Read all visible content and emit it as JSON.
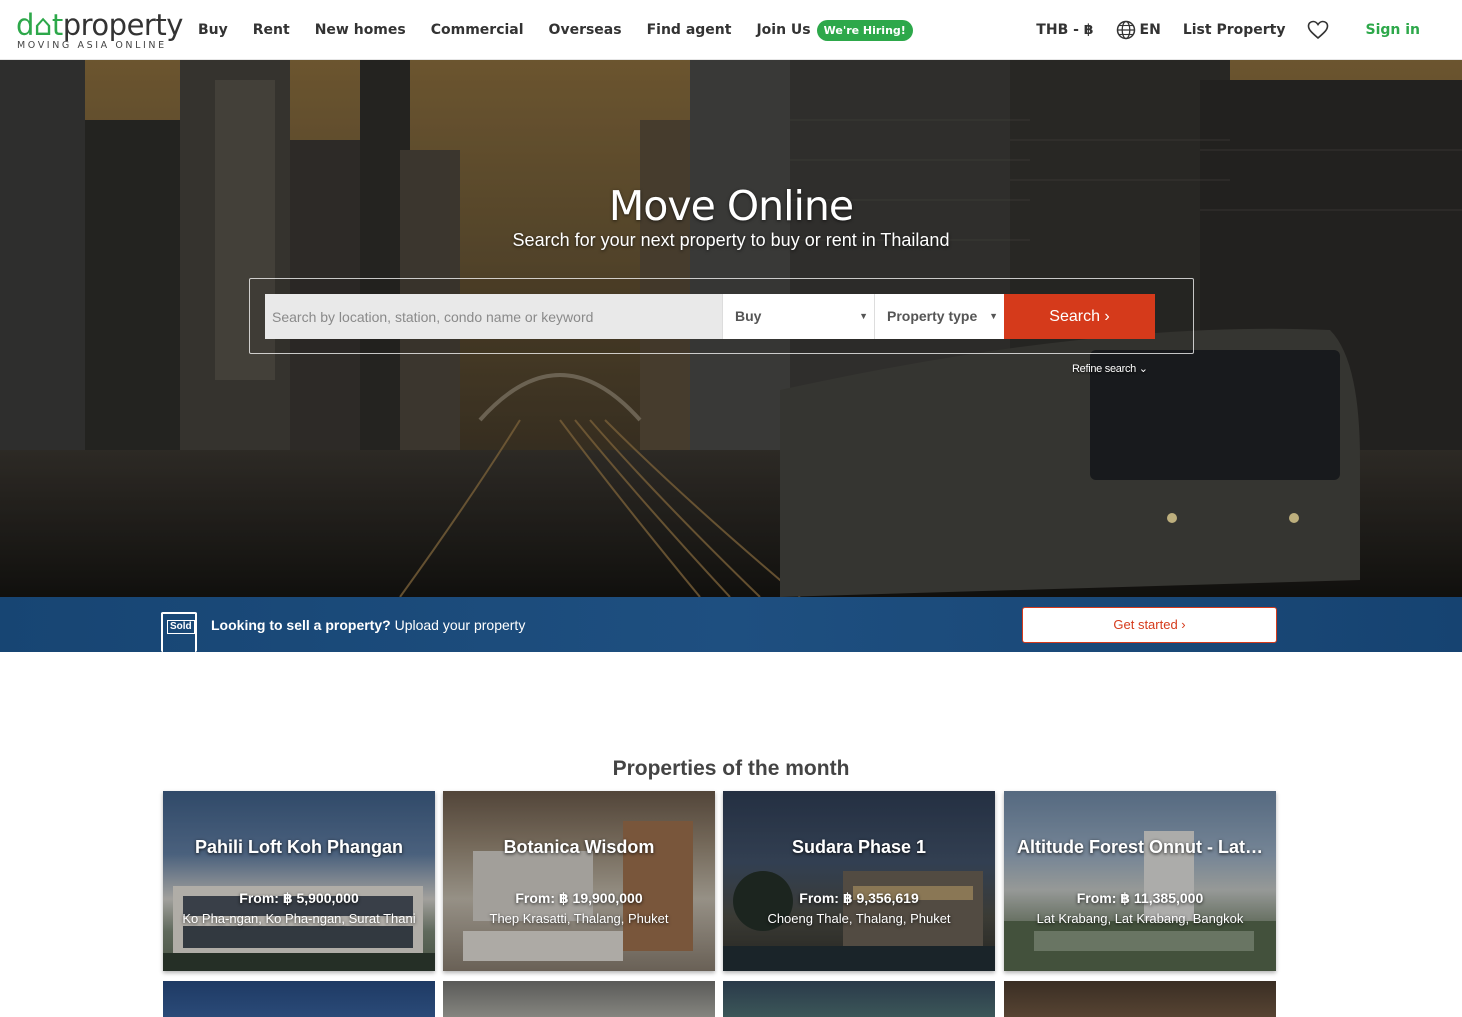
{
  "brand": {
    "logo_text_a": "d",
    "logo_text_b": "t",
    "logo_text_c": "property",
    "tagline": "MOVING ASIA ONLINE",
    "accent": "#2da84a",
    "cta_color": "#d53a1b"
  },
  "nav": {
    "items": [
      {
        "label": "Buy"
      },
      {
        "label": "Rent"
      },
      {
        "label": "New homes"
      },
      {
        "label": "Commercial"
      },
      {
        "label": "Overseas"
      },
      {
        "label": "Find agent"
      }
    ],
    "join_label": "Join Us",
    "hiring_badge": "We're Hiring!"
  },
  "header_right": {
    "currency": "THB - ฿",
    "language": "EN",
    "list_property": "List Property",
    "favorites_icon": "heart-icon",
    "sign_in": "Sign in"
  },
  "hero": {
    "title": "Move Online",
    "subtitle": "Search for your next property to buy or rent in Thailand",
    "search_placeholder": "Search by location, station, condo name or keyword",
    "listing_type": "Buy",
    "property_type": "Property type",
    "search_button": "Search ›",
    "refine": "Refine search ⌄"
  },
  "sell_banner": {
    "icon_label": "Sold",
    "headline": "Looking to sell a property?",
    "subtext": " Upload your property",
    "button": "Get started ›"
  },
  "properties": {
    "title": "Properties of the month",
    "cards": [
      {
        "name": "Pahili Loft Koh Phangan",
        "price": "From: ฿ 5,900,000",
        "location": "Ko Pha-ngan, Ko Pha-ngan, Surat Thani"
      },
      {
        "name": "Botanica Wisdom",
        "price": "From: ฿ 19,900,000",
        "location": "Thep Krasatti, Thalang, Phuket"
      },
      {
        "name": "Sudara Phase 1",
        "price": "From: ฿ 9,356,619",
        "location": "Choeng Thale, Thalang, Phuket"
      },
      {
        "name": "Altitude Forest Onnut - Lat…",
        "price": "From: ฿ 11,385,000",
        "location": "Lat Krabang, Lat Krabang, Bangkok"
      }
    ]
  }
}
